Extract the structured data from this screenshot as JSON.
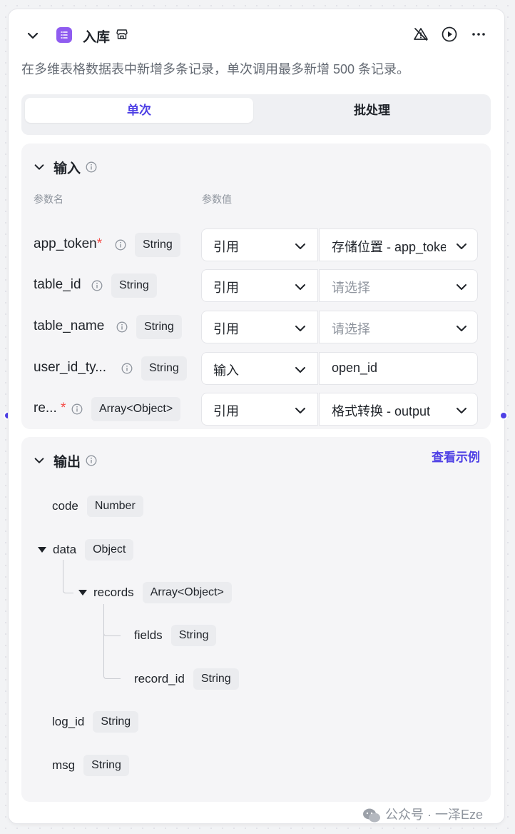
{
  "node": {
    "title": "入库",
    "description": "在多维表格数据表中新增多条记录，单次调用最多新增 500 条记录。"
  },
  "tabs": [
    {
      "label": "单次",
      "active": true
    },
    {
      "label": "批处理",
      "active": false
    }
  ],
  "input": {
    "title": "输入",
    "col_name": "参数名",
    "col_value": "参数值",
    "params": [
      {
        "name": "app_token",
        "required": "*",
        "type": "String",
        "source": "引用",
        "value": "存储位置 - app_token",
        "is_placeholder": false
      },
      {
        "name": "table_id",
        "required": "",
        "type": "String",
        "source": "引用",
        "value": "请选择",
        "is_placeholder": true
      },
      {
        "name": "table_name",
        "required": "",
        "type": "String",
        "source": "引用",
        "value": "请选择",
        "is_placeholder": true
      },
      {
        "name": "user_id_ty...",
        "required": "",
        "type": "String",
        "source": "输入",
        "value": "open_id",
        "is_placeholder": false
      },
      {
        "name": "re...",
        "required": "*",
        "type": "Array<Object>",
        "source": "引用",
        "value": "格式转换 - output",
        "is_placeholder": false
      }
    ]
  },
  "output": {
    "title": "输出",
    "example_link": "查看示例",
    "fields": [
      {
        "name": "code",
        "type": "Number"
      },
      {
        "name": "data",
        "type": "Object"
      },
      {
        "name": "records",
        "type": "Array<Object>"
      },
      {
        "name": "fields",
        "type": "String"
      },
      {
        "name": "record_id",
        "type": "String"
      },
      {
        "name": "log_id",
        "type": "String"
      },
      {
        "name": "msg",
        "type": "String"
      }
    ]
  },
  "watermark": "公众号 · 一泽Eze",
  "colors": {
    "accent": "#4e40e5",
    "required": "#f54a45",
    "app_icon": "#8f5cf0"
  },
  "icons": [
    "chevron-down-icon",
    "bitable-icon",
    "store-icon",
    "warning-off-icon",
    "play-icon",
    "more-icon",
    "info-icon",
    "wechat-icon"
  ]
}
